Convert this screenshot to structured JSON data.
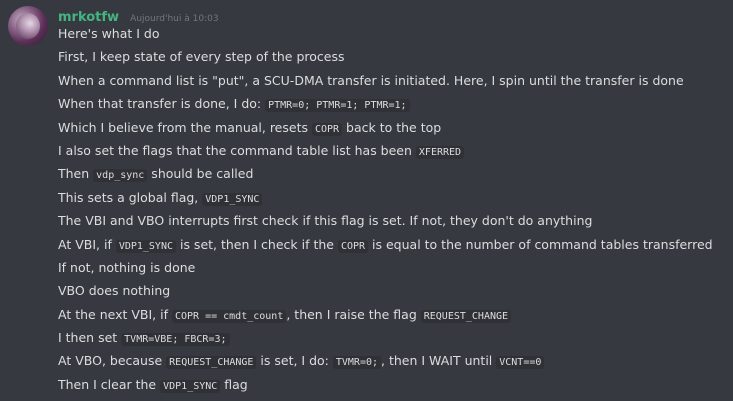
{
  "author": {
    "username": "mrkotfw",
    "timestamp": "Aujourd'hui à 10:03"
  },
  "message": {
    "lines": [
      [
        {
          "t": "Here's what I do"
        }
      ],
      [
        {
          "t": "First, I keep state of every step of the process"
        }
      ],
      [
        {
          "t": "When a command list is \"put\", a SCU-DMA transfer is initiated. Here, I spin until the transfer is done"
        }
      ],
      [
        {
          "t": "When that transfer is done, I do: "
        },
        {
          "c": "PTMR=0; PTMR=1; PTMR=1;"
        }
      ],
      [
        {
          "t": "Which I believe from the manual, resets "
        },
        {
          "c": "COPR"
        },
        {
          "t": " back to the top"
        }
      ],
      [
        {
          "t": "I also set the flags that the command table list has been "
        },
        {
          "c": "XFERRED"
        }
      ],
      [
        {
          "t": "Then "
        },
        {
          "c": "vdp_sync"
        },
        {
          "t": " should be called"
        }
      ],
      [
        {
          "t": "This sets a global flag, "
        },
        {
          "c": "VDP1_SYNC"
        }
      ],
      [
        {
          "t": "The VBI and VBO interrupts first check if this flag is set. If not, they don't do anything"
        }
      ],
      [
        {
          "t": "At VBI, if "
        },
        {
          "c": "VDP1_SYNC"
        },
        {
          "t": " is set, then I check if the "
        },
        {
          "c": "COPR"
        },
        {
          "t": " is equal to the number of command tables transferred"
        }
      ],
      [
        {
          "t": "If not, nothing is done"
        }
      ],
      [
        {
          "t": "VBO does nothing"
        }
      ],
      [
        {
          "t": "At the next VBI, if "
        },
        {
          "c": "COPR == cmdt_count"
        },
        {
          "t": ", then I raise the flag "
        },
        {
          "c": "REQUEST_CHANGE"
        }
      ],
      [
        {
          "t": "I then set "
        },
        {
          "c": "TVMR=VBE; FBCR=3;"
        }
      ],
      [
        {
          "t": "At VBO, because "
        },
        {
          "c": "REQUEST_CHANGE"
        },
        {
          "t": " is set, I do: "
        },
        {
          "c": "TVMR=0;"
        },
        {
          "t": ", then I WAIT until "
        },
        {
          "c": "VCNT==0"
        }
      ],
      [
        {
          "t": "Then I clear the "
        },
        {
          "c": "VDP1_SYNC"
        },
        {
          "t": " flag"
        }
      ]
    ]
  }
}
